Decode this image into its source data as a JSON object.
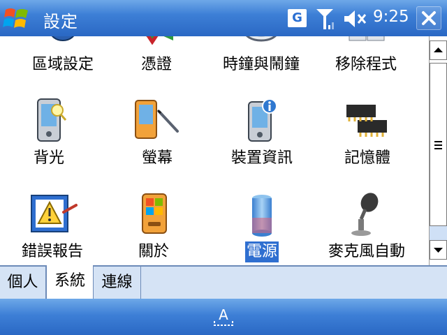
{
  "title_bar": {
    "title": "設定",
    "clock": "9:25",
    "tray_badge": "G",
    "icons": [
      "windows-start-icon",
      "gprs-badge-icon",
      "signal-icon",
      "speaker-mute-icon",
      "close-icon"
    ]
  },
  "items": [
    {
      "label": "區域設定",
      "icon": "regional-settings-icon"
    },
    {
      "label": "憑證",
      "icon": "certificates-icon"
    },
    {
      "label": "時鐘與鬧鐘",
      "icon": "clock-icon"
    },
    {
      "label": "移除程式",
      "icon": "remove-programs-icon"
    },
    {
      "label": "背光",
      "icon": "backlight-icon"
    },
    {
      "label": "螢幕",
      "icon": "screen-icon"
    },
    {
      "label": "裝置資訊",
      "icon": "device-info-icon"
    },
    {
      "label": "記憶體",
      "icon": "memory-icon"
    },
    {
      "label": "錯誤報告",
      "icon": "error-reporting-icon"
    },
    {
      "label": "關於",
      "icon": "about-icon"
    },
    {
      "label": "電源",
      "icon": "power-icon",
      "selected": true
    },
    {
      "label": "麥克風自動",
      "icon": "microphone-icon"
    }
  ],
  "tabs": [
    {
      "label": "個人",
      "active": false
    },
    {
      "label": "系統",
      "active": true
    },
    {
      "label": "連線",
      "active": false
    }
  ],
  "menu_bar": {
    "sip_letter": "A"
  },
  "colors": {
    "title_bar": "#3d7fd6",
    "selection": "#2f6fd0",
    "tab_bar": "#d5e3f5",
    "scroll_track": "#cfe0f6"
  }
}
